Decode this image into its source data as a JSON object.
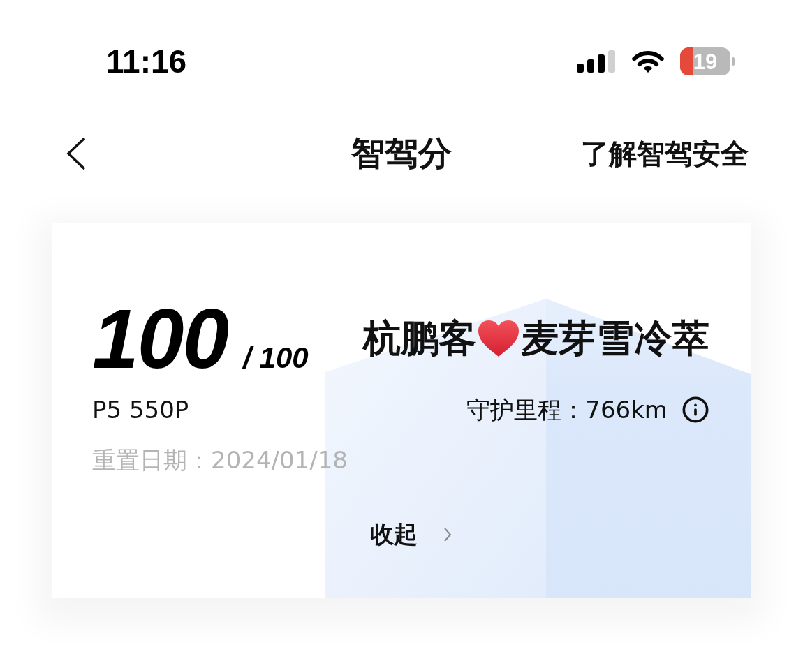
{
  "status_bar": {
    "time": "11:16",
    "battery": "19"
  },
  "nav": {
    "title": "智驾分",
    "link": "了解智驾安全"
  },
  "score_card": {
    "score": "100",
    "score_total": "/ 100",
    "nickname": [
      {
        "kind": "text",
        "text": "杭鹏客"
      },
      {
        "kind": "heart"
      },
      {
        "kind": "text",
        "text": "麦芽雪冷萃"
      }
    ],
    "vehicle": "P5 550P",
    "mileage": "守护里程：766km",
    "reset_date": "重置日期：2024/01/18",
    "collapse": "收起"
  }
}
